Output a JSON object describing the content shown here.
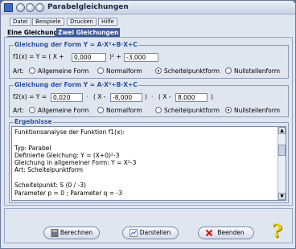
{
  "window": {
    "title": "Parabelgleichungen"
  },
  "menu": [
    "Datei",
    "Beispiele",
    "Drucken",
    "Hilfe"
  ],
  "tabs": [
    "Eine Gleichung",
    "Zwei Gleichungen"
  ],
  "group1": {
    "title": "Gleichung der Form Y = A·X²+B·X+C",
    "eq_prefix": "f1(x) = Y = ( X +",
    "eq_mid": ")² +",
    "value1": "0,000",
    "value2": "-3,000",
    "art_label": "Art:",
    "options": [
      "Allgemeine Form",
      "Normalform",
      "Scheitelpunktform",
      "Nullstellenform"
    ],
    "selected": "Scheitelpunktform"
  },
  "group2": {
    "title": "Gleichung der Form Y = A·X²+B·X+C",
    "eq_prefix": "f2(x) = Y =",
    "dot1": "·",
    "paren1": "( X -",
    "close1": ")",
    "dot2": "·",
    "paren2": "( X -",
    "close2": ")",
    "value1": "0,020",
    "value2": "-8,000",
    "value3": "8,000",
    "art_label": "Art:",
    "options": [
      "Allgemeine Form",
      "Normalform",
      "Scheitelpunktform",
      "Nullstellenform"
    ],
    "selected": "Nullstellenform"
  },
  "results": {
    "title": "Ergebnisse",
    "lines": [
      "Funktionsanalyse der Funktion f1(x):",
      "",
      "Typ: Parabel",
      "Definierte Gleichung: Y = (X+0)²-3",
      "Gleichung in allgemeiner Form: Y = X²-3",
      "Art: Scheitelpunktform",
      "",
      "Scheitelpunkt: S (0 / -3)",
      "Parameter p = 0 ; Parameter q = -3"
    ]
  },
  "buttons": {
    "calculate": "Berechnen",
    "show": "Darstellen",
    "exit": "Beenden"
  },
  "help_glyph": "?"
}
